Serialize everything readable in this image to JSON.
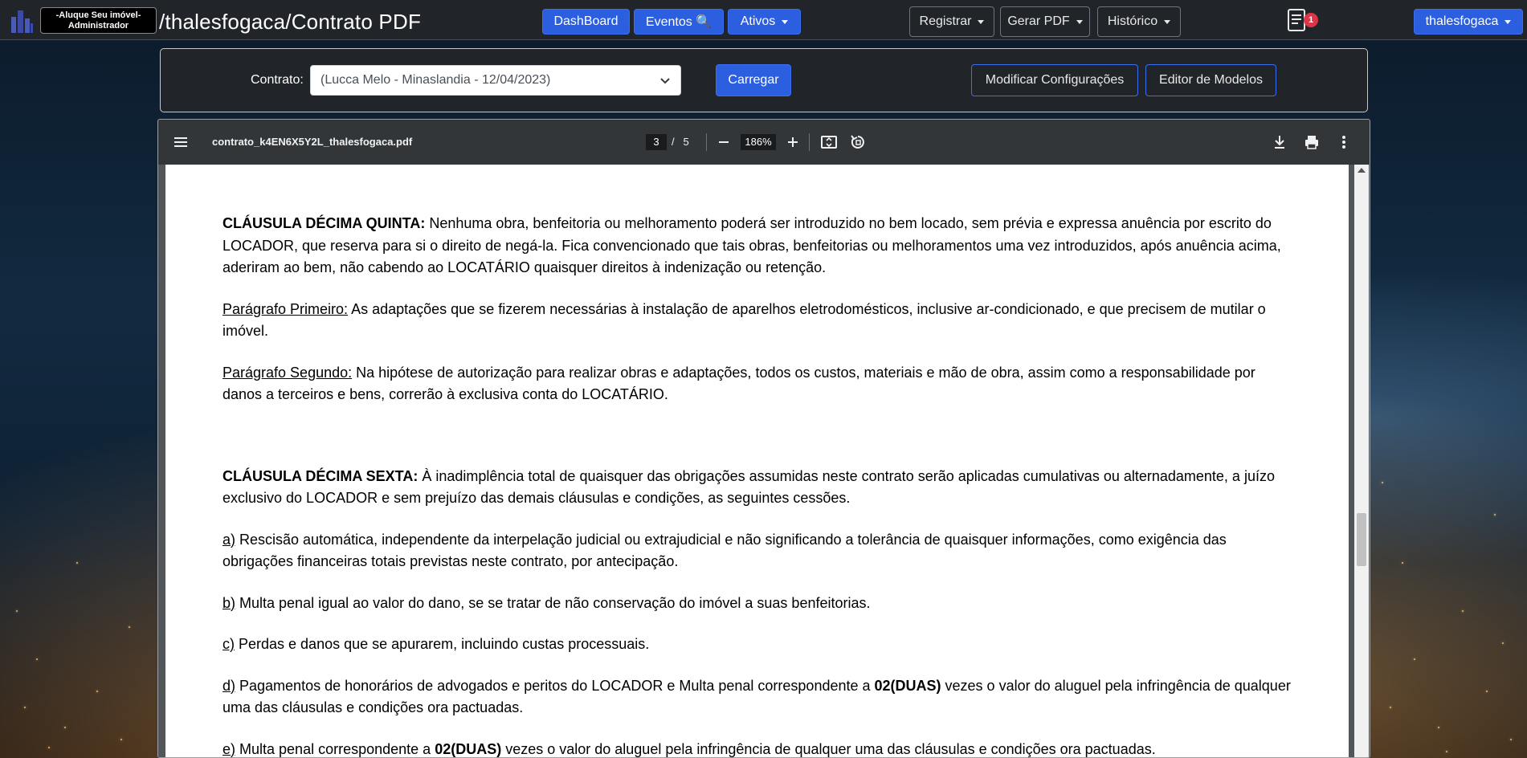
{
  "navbar": {
    "brand_line1": "-Aluque Seu imóvel-",
    "brand_line2": "Administrador",
    "path_title": "/thalesfogaca/Contrato PDF",
    "dashboard": "DashBoard",
    "eventos": "Eventos 🔍",
    "ativos": "Ativos",
    "registrar": "Registrar",
    "gerar_pdf": "Gerar PDF",
    "historico": "Histórico",
    "notif_count": "1",
    "user": "thalesfogaca",
    "accent_color": "#2b5fe0"
  },
  "contract": {
    "label": "Contrato:",
    "selected": "(Lucca Melo - Minaslandia - 12/04/2023)",
    "load_button": "Carregar",
    "modify_button": "Modificar Configurações",
    "editor_button": "Editor de Modelos"
  },
  "pdf": {
    "filename": "contrato_k4EN6X5Y2L_thalesfogaca.pdf",
    "current_page": "3",
    "page_separator": "/",
    "total_pages": "5",
    "zoom": "186%",
    "icons": [
      "menu-icon",
      "zoom-out-icon",
      "zoom-in-icon",
      "fit-page-icon",
      "rotate-icon",
      "download-icon",
      "print-icon",
      "more-icon"
    ]
  },
  "document": {
    "c15_title": "CLÁUSULA DÉCIMA QUINTA:",
    "c15_text": " Nenhuma obra, benfeitoria ou melhoramento poderá ser introduzido no bem locado, sem prévia e expressa anuência por escrito do LOCADOR, que reserva para si o direito de negá-la. Fica convencionado que tais obras, benfeitorias ou melhoramentos uma vez introduzidos, após anuência acima, aderiram ao bem, não cabendo ao LOCATÁRIO quaisquer direitos à indenização ou retenção.",
    "p1_label": "Parágrafo Primeiro:",
    "p1_text": " As adaptações que se fizerem necessárias à instalação de aparelhos eletrodomésticos, inclusive ar-condicionado, e que precisem de mutilar o imóvel.",
    "p2_label": "Parágrafo Segundo:",
    "p2_text": " Na hipótese de autorização para realizar obras e adaptações, todos os custos, materiais e mão de obra, assim como a responsabilidade por danos a terceiros e bens, correrão à exclusiva conta do LOCATÁRIO.",
    "c16_title": "CLÁUSULA DÉCIMA SEXTA:",
    "c16_text": " À inadimplência total de quaisquer das obrigações assumidas neste contrato serão aplicadas cumulativas ou alternadamente, a juízo exclusivo do LOCADOR e sem prejuízo das demais cláusulas e condições, as seguintes cessões.",
    "a_label": "a)",
    "a_text": " Rescisão automática, independente da interpelação judicial ou extrajudicial e não significando a tolerância de quaisquer informações, como exigência das obrigações financeiras totais previstas neste contrato, por antecipação.",
    "b_label": "b)",
    "b_text": " Multa penal igual ao valor do dano, se se tratar de não conservação do imóvel a suas benfeitorias.",
    "c_label": "c)",
    "c_text": " Perdas e danos que se apurarem, incluindo custas processuais.",
    "d_label": "d)",
    "d_text1": " Pagamentos de honorários de advogados e peritos do LOCADOR e Multa penal correspondente a ",
    "d_bold": "02(DUAS)",
    "d_text2": " vezes o valor do aluguel pela infringência de qualquer uma das cláusulas e condições ora pactuadas.",
    "e_label": "e)",
    "e_text1": " Multa penal correspondente a ",
    "e_bold": "02(DUAS)",
    "e_text2": " vezes o valor do aluguel pela infringência de qualquer uma das cláusulas e condições ora pactuadas."
  }
}
